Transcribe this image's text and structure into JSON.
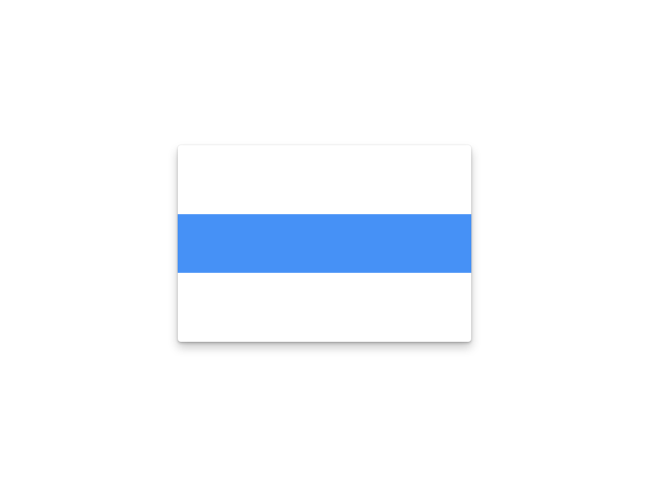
{
  "card": {
    "background_color": "#ffffff",
    "band_color": "#4691f6"
  }
}
